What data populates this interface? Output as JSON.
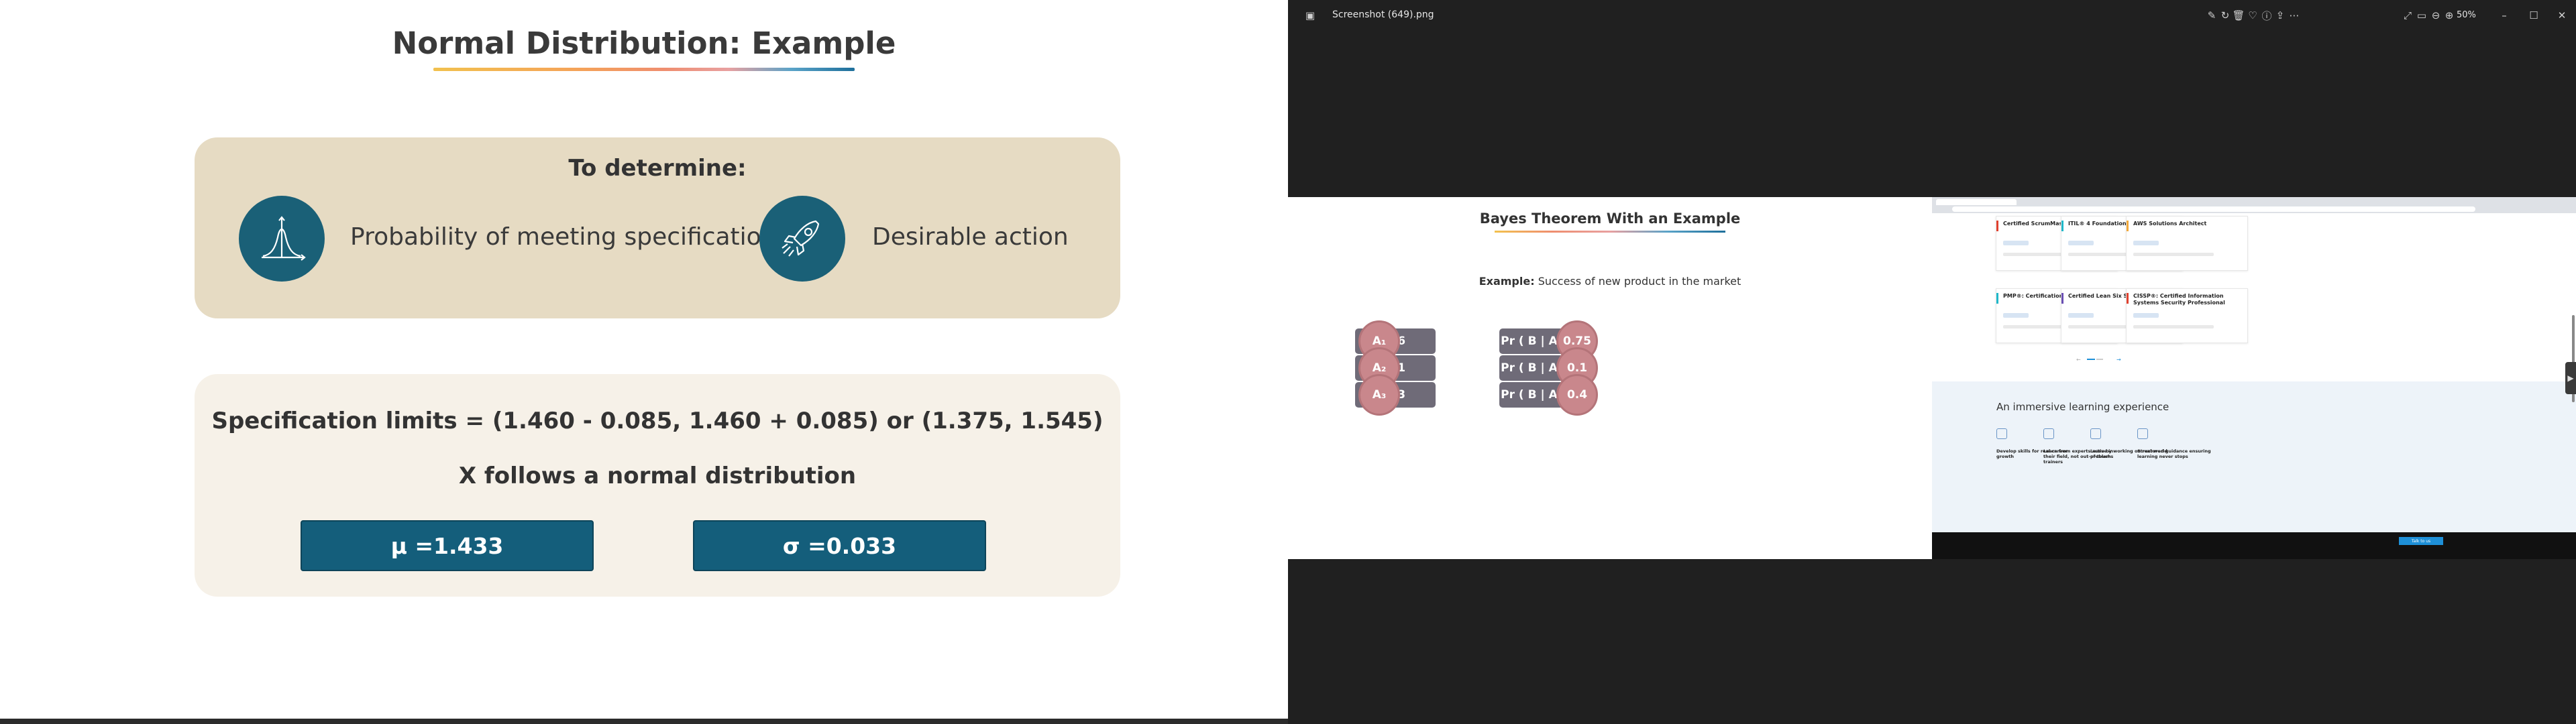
{
  "slide": {
    "title": "Normal Distribution: Example",
    "determine": {
      "heading": "To determine:",
      "items": [
        {
          "label": "Probability of meeting specifications",
          "icon": "bell-curve-icon"
        },
        {
          "label": "Desirable action",
          "icon": "rocket-icon"
        }
      ]
    },
    "spec": {
      "limits_text": "Specification limits = (1.460 - 0.085, 1.460 + 0.085) or (1.375, 1.545)",
      "distribution_text": "X follows a normal distribution",
      "mu_label": "μ =1.433",
      "sigma_label": "σ =0.033"
    },
    "colors": {
      "accent": "#145e7b",
      "box1": "#e6dbc3",
      "box2": "#f6f1e8",
      "icon_bg": "#1a6077"
    }
  },
  "viewer": {
    "filename": "Screenshot (649).png",
    "zoom": "50%",
    "toolbar_icons": [
      "edit-icon",
      "rotate-icon",
      "delete-icon",
      "favorite-icon",
      "info-icon",
      "share-icon",
      "more-icon"
    ],
    "right_icons": [
      "fullscreen-icon",
      "fit-icon",
      "zoom-out-icon",
      "zoom-in-icon"
    ],
    "window_controls": [
      "minimize-icon",
      "maximize-icon",
      "close-icon"
    ]
  },
  "bayes": {
    "title": "Bayes Theorem With an Example",
    "example_bold": "Example:",
    "example_text": " Success of new product in the market",
    "rows": [
      {
        "a_label": "A₁",
        "a_value": "0.6",
        "pr_label": "Pr ( B | A₁ )",
        "pr_value": "0.75"
      },
      {
        "a_label": "A₂",
        "a_value": "0.1",
        "pr_label": "Pr ( B | A₂ )",
        "pr_value": "0.1"
      },
      {
        "a_label": "A₃",
        "a_value": "0.3",
        "pr_label": "Pr ( B | A₃ )",
        "pr_value": "0.4"
      }
    ]
  },
  "site": {
    "cards": [
      {
        "title": "Certified ScrumMaster® (CSM)",
        "bar": "#e0412f"
      },
      {
        "title": "ITIL® 4 Foundation",
        "bar": "#1fb8c9"
      },
      {
        "title": "AWS Solutions Architect",
        "bar": "#f2a93b"
      },
      {
        "title": "PMP®: Certification Training",
        "bar": "#1fb8c9"
      },
      {
        "title": "Certified Lean Six Sigma Green Belt",
        "bar": "#6a4fb3"
      },
      {
        "title": "CISSP®: Certified Information Systems Security Professional",
        "bar": "#e0412f"
      }
    ],
    "immersive_title": "An immersive learning experience",
    "features": [
      {
        "title": "Develop skills for real career growth"
      },
      {
        "title": "Learn from experts active in their field, not out-of-touch trainers"
      },
      {
        "title": "Learn by working on real-world problems"
      },
      {
        "title": "Structured guidance ensuring learning never stops"
      }
    ],
    "footer_cta": "Talk to us"
  }
}
